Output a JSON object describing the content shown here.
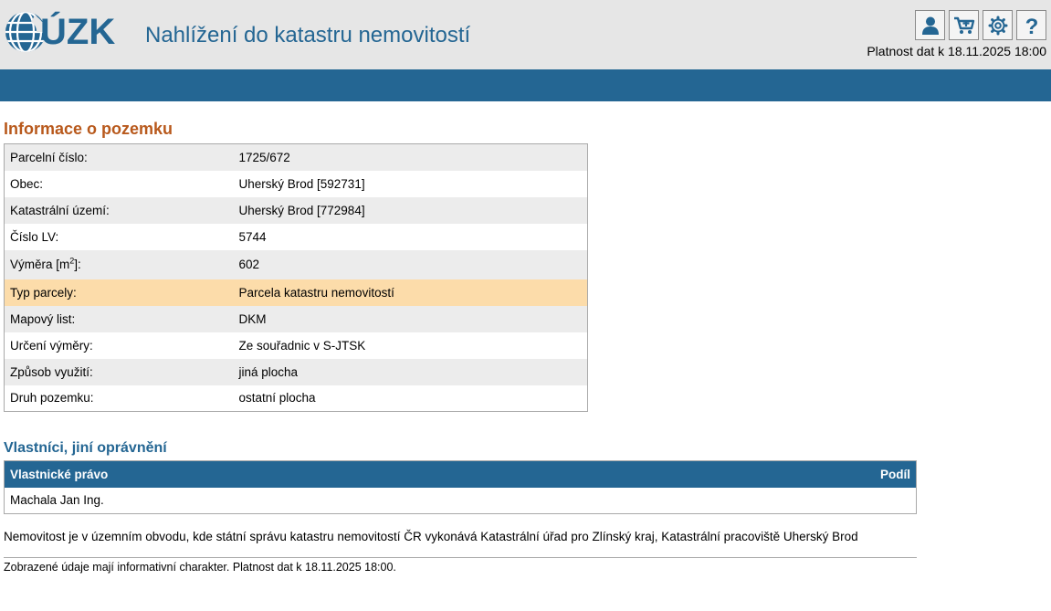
{
  "header": {
    "logo_text": "ÚZK",
    "app_title": "Nahlížení do katastru nemovitostí",
    "validity": "Platnost dat k 18.11.2025 18:00",
    "icons": [
      "user-icon",
      "cart-icon",
      "gear-icon",
      "help-icon"
    ]
  },
  "parcel": {
    "title": "Informace o pozemku",
    "rows": [
      {
        "label": "Parcelní číslo:",
        "value": "1725/672"
      },
      {
        "label": "Obec:",
        "value": "Uherský Brod [592731]"
      },
      {
        "label": "Katastrální území:",
        "value": "Uherský Brod [772984]"
      },
      {
        "label": "Číslo LV:",
        "value": "5744"
      },
      {
        "label_prefix": "Výměra [m",
        "label_sup": "2",
        "label_suffix": "]:",
        "value": "602"
      },
      {
        "label": "Typ parcely:",
        "value": "Parcela katastru nemovitostí"
      },
      {
        "label": "Mapový list:",
        "value": "DKM"
      },
      {
        "label": "Určení výměry:",
        "value": "Ze souřadnic v S-JTSK"
      },
      {
        "label": "Způsob využití:",
        "value": "jiná plocha"
      },
      {
        "label": "Druh pozemku:",
        "value": "ostatní plocha"
      }
    ]
  },
  "owners": {
    "title": "Vlastníci, jiní oprávnění",
    "header_left": "Vlastnické právo",
    "header_right": "Podíl",
    "rows": [
      {
        "name": "Machala Jan Ing.",
        "share": ""
      }
    ]
  },
  "note": "Nemovitost je v územním obvodu, kde státní správu katastru nemovitostí ČR vykonává Katastrální úřad pro Zlínský kraj, Katastrální pracoviště Uherský Brod",
  "footer": "Zobrazené údaje mají informativní charakter. Platnost dat k 18.11.2025 18:00.",
  "colors": {
    "brand_blue": "#246693",
    "title_orange": "#b8591c",
    "highlight_row": "#fcdcaa",
    "header_bg": "#e6e6e6"
  }
}
